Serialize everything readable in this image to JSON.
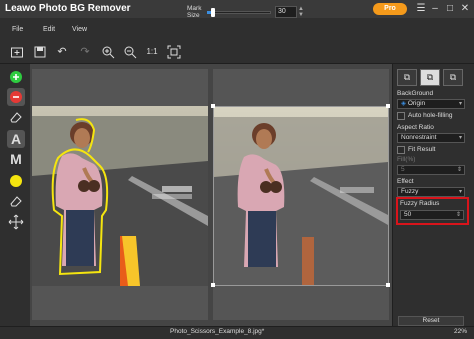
{
  "app": {
    "title": "Leawo Photo BG Remover",
    "pro_label": "Pro"
  },
  "menu": {
    "file": "File",
    "edit": "Edit",
    "view": "View"
  },
  "toolbar": {
    "zoom_ratio": "1:1",
    "mark_size_label": "Mark Size",
    "mark_size_value": "30",
    "mark_size_fraction": 0.1
  },
  "left_tools": [
    "add-green",
    "remove-red",
    "eraser",
    "A",
    "M",
    "yellow-brush",
    "eraser-2",
    "move"
  ],
  "right_panel": {
    "background_label": "BackGround",
    "background_value": "Origin",
    "auto_hole_label": "Auto hole-filling",
    "aspect_label": "Aspect Ratio",
    "aspect_value": "Nonrestraint",
    "fit_label": "Fit Result",
    "fill_label": "Fill(%)",
    "fill_value": "5",
    "effect_label": "Effect",
    "effect_value": "Fuzzy",
    "fuzzy_label": "Fuzzy Radius",
    "fuzzy_value": "50",
    "reset_label": "Reset"
  },
  "status": {
    "filename": "Photo_Scissors_Example_8.jpg*",
    "zoom": "22%"
  },
  "colors": {
    "accent": "#3b8ee0",
    "pro": "#f59a1b",
    "highlight": "#d9141b"
  }
}
